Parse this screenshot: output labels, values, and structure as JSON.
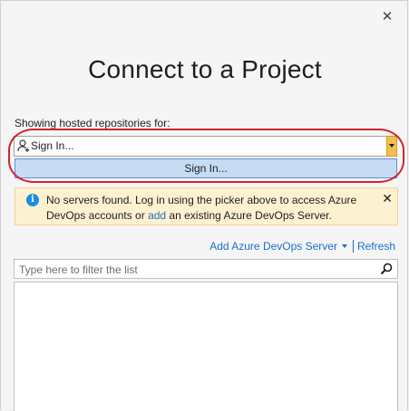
{
  "dialog": {
    "close_glyph": "✕",
    "title": "Connect to a Project",
    "showing_label": "Showing hosted repositories for:",
    "picker": {
      "value": "Sign In..."
    },
    "signin_button": "Sign In...",
    "info": {
      "text_part1": "No servers found. Log in using the picker above to access Azure DevOps accounts or ",
      "link": "add",
      "text_part2": " an existing Azure DevOps Server.",
      "dismiss": "✕"
    },
    "links": {
      "add_server": "Add Azure DevOps Server",
      "refresh": "Refresh"
    },
    "filter": {
      "placeholder": "Type here to filter the list",
      "value": ""
    }
  },
  "colors": {
    "accent": "#1a6fc9",
    "highlight_outline": "#d4242c",
    "info_background": "#fdf1d0",
    "info_icon": "#1c8de0",
    "button_background": "#c6dcf5"
  }
}
